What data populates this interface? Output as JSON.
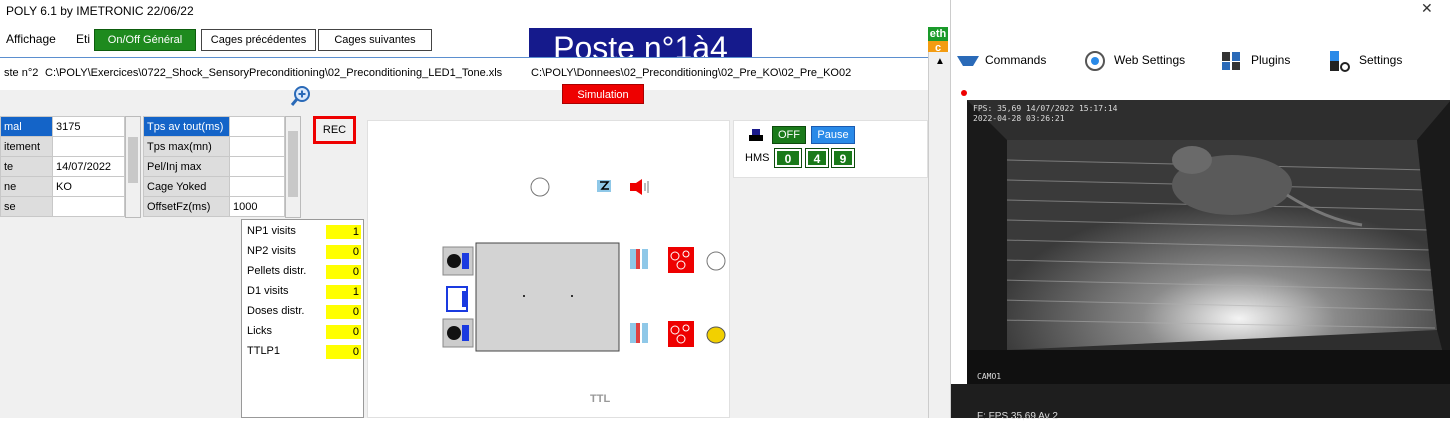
{
  "window": {
    "title": "POLY 6.1 by IMETRONIC  22/06/22"
  },
  "menu": {
    "items": [
      "Affichage",
      "Eti"
    ]
  },
  "toolbar": {
    "onoff_label": "On/Off Général",
    "prev_label": "Cages précédentes",
    "next_label": "Cages suivantes"
  },
  "banner": {
    "title": "Poste n°1à4"
  },
  "eth": {
    "top": "eth",
    "bottom": "c"
  },
  "inner": {
    "station": "ste n°2",
    "exercise_path": "C:\\POLY\\Exercices\\0722_Shock_SensoryPreconditioning\\02_Preconditioning_LED1_Tone.xls",
    "data_path": "C:\\POLY\\Donnees\\02_Preconditioning\\02_Pre_KO\\02_Pre_KO02",
    "simulation_label": "Simulation",
    "rec_label": "REC"
  },
  "grid1": {
    "rows": [
      {
        "label": "mal",
        "value": "3175"
      },
      {
        "label": "itement",
        "value": ""
      },
      {
        "label": "te",
        "value": "14/07/2022"
      },
      {
        "label": "ne",
        "value": "KO"
      },
      {
        "label": "se",
        "value": ""
      }
    ]
  },
  "grid2": {
    "rows": [
      {
        "label": "Tps av tout(ms)",
        "value": ""
      },
      {
        "label": "Tps max(mn)",
        "value": ""
      },
      {
        "label": "Pel/Inj max",
        "value": ""
      },
      {
        "label": "Cage Yoked",
        "value": ""
      },
      {
        "label": "OffsetFz(ms)",
        "value": "1000"
      }
    ]
  },
  "counters": {
    "rows": [
      {
        "label": "NP1 visits",
        "value": "1"
      },
      {
        "label": "NP2 visits",
        "value": "0"
      },
      {
        "label": "Pellets distr.",
        "value": "0"
      },
      {
        "label": "D1 visits",
        "value": "1"
      },
      {
        "label": "Doses distr.",
        "value": "0"
      },
      {
        "label": "Licks",
        "value": "0"
      },
      {
        "label": "TTLP1",
        "value": "0"
      }
    ]
  },
  "control": {
    "off_label": "OFF",
    "pause_label": "Pause",
    "hms_label": "HMS",
    "h": "0",
    "m": "4",
    "s": "9"
  },
  "cage": {
    "ttl_label": "TTL"
  },
  "right_toolbar": {
    "commands": "Commands",
    "web_settings": "Web Settings",
    "plugins": "Plugins",
    "settings": "Settings"
  },
  "video": {
    "overlay_line1": "FPS: 35,69 14/07/2022 15:17:14",
    "overlay_line2": "2022-04-28  03:26:21",
    "camera_label": "CAMO1",
    "footer": "F: FPS 35,69 Av 2"
  },
  "colors": {
    "green": "#1e8a1e",
    "banner": "#151a8c",
    "simulation": "#ee0000",
    "counter": "#ffff00",
    "select": "#1464c8"
  }
}
